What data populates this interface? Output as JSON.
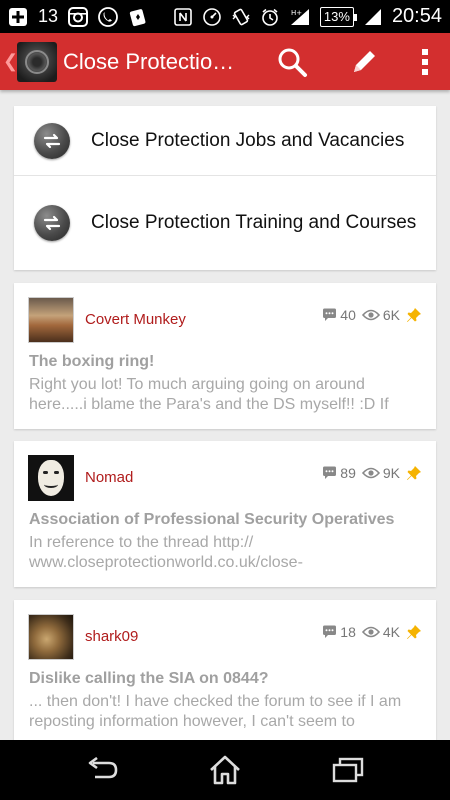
{
  "status_bar": {
    "notification_count": "13",
    "battery": "13%",
    "time": "20:54",
    "network": "H+"
  },
  "action_bar": {
    "title": "Close Protectio…",
    "color": "#d32f2f"
  },
  "categories": [
    {
      "label": "Close Protection Jobs and Vacancies",
      "icon": "forum-arrows-icon"
    },
    {
      "label": "Close Protection Training and Courses",
      "icon": "forum-arrows-icon"
    }
  ],
  "topics": [
    {
      "author": "Covert Munkey",
      "replies": "40",
      "views": "6K",
      "title": "The boxing ring!",
      "snippet": "Right you lot! To much arguing going on around here.....i blame the Para's and the DS myself!! :D If",
      "avatar": "sunset"
    },
    {
      "author": "Nomad",
      "replies": "89",
      "views": "9K",
      "title": "Association of Professional Security Operatives",
      "snippet": "In reference to the thread http:// www.closeprotectionworld.co.uk/close-",
      "avatar": "mask"
    },
    {
      "author": "shark09",
      "replies": "18",
      "views": "4K",
      "title": "Dislike calling the SIA on 0844?",
      "snippet": "... then don't! I have checked the forum to see if I am reposting information however, I can't seem to",
      "avatar": "shark"
    }
  ],
  "colors": {
    "accent": "#d32f2f",
    "author": "#b01c1c",
    "pin": "#f5b301"
  }
}
